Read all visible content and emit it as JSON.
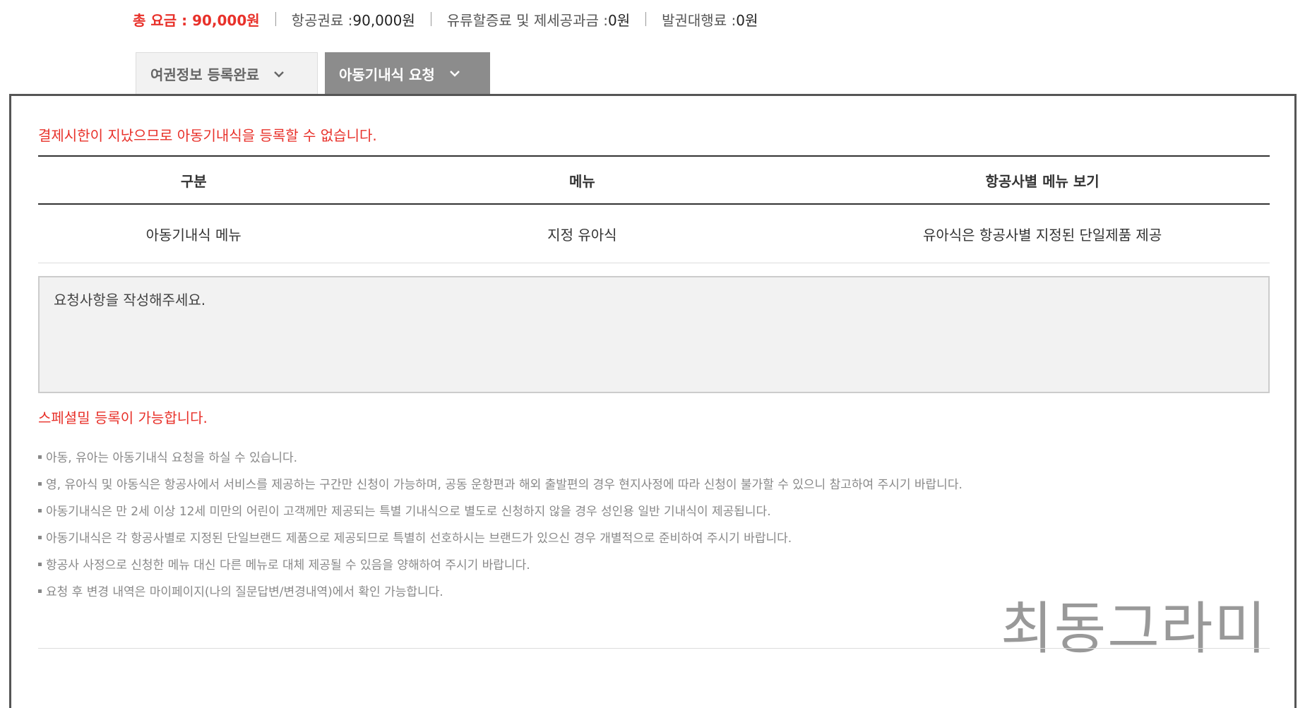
{
  "fare": {
    "total": "총 요금 : 90,000원",
    "airfare_label": "항공권료 :",
    "airfare_value": "90,000원",
    "fuel_label": "유류할증료 및 제세공과금 :",
    "fuel_value": "0원",
    "issue_fee_label": "발권대행료 :",
    "issue_fee_value": "0원"
  },
  "tabs": [
    {
      "label": "여권정보 등록완료",
      "active": false
    },
    {
      "label": "아동기내식 요청",
      "active": true
    }
  ],
  "panel": {
    "warning": "결제시한이 지났으므로 아동기내식을 등록할 수 없습니다.",
    "table": {
      "headers": [
        "구분",
        "메뉴",
        "항공사별 메뉴 보기"
      ],
      "rows": [
        [
          "아동기내식 메뉴",
          "지정 유아식",
          "유아식은 항공사별 지정된 단일제품 제공"
        ]
      ]
    },
    "request_placeholder": "요청사항을 작성해주세요.",
    "special_note": "스페셜밀 등록이 가능합니다.",
    "notices": [
      "아동, 유아는 아동기내식 요청을 하실 수 있습니다.",
      "영, 유아식 및 아동식은 항공사에서 서비스를 제공하는 구간만 신청이 가능하며, 공동 운항편과 해외 출발편의 경우 현지사정에 따라 신청이 불가할 수 있으니 참고하여 주시기 바랍니다.",
      "아동기내식은 만 2세 이상 12세 미만의 어린이 고객께만 제공되는 특별 기내식으로 별도로 신청하지 않을 경우 성인용 일반 기내식이 제공됩니다.",
      "아동기내식은 각 항공사별로 지정된 단일브랜드 제품으로 제공되므로 특별히 선호하시는 브랜드가 있으신 경우 개별적으로 준비하여 주시기 바랍니다.",
      "항공사 사정으로 신청한 메뉴 대신 다른 메뉴로 대체 제공될 수 있음을 양해하여 주시기 바랍니다.",
      "요청 후 변경 내역은 마이페이지(나의 질문답변/변경내역)에서 확인 가능합니다."
    ],
    "watermark": "최동그라미"
  },
  "icons": {
    "tab_chevron": "chevron-down-icon"
  },
  "colors": {
    "alert": "#e8312a",
    "active_tab": "#8c8c8c",
    "panel_border": "#555555"
  }
}
